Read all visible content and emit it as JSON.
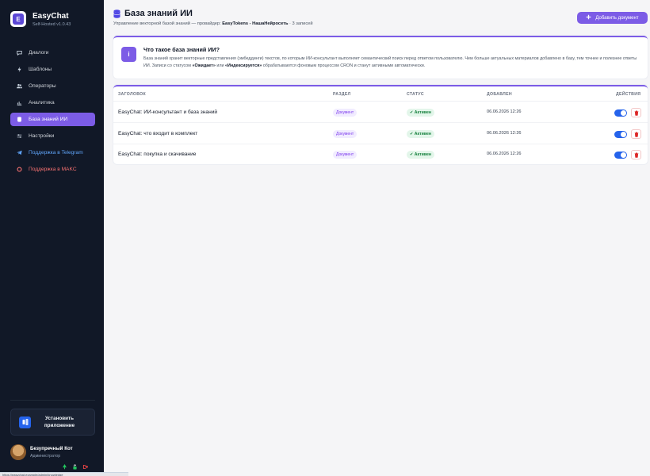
{
  "app": {
    "name": "EasyChat",
    "version": "Self-Hosted v1.0.43",
    "logo_letter": "E"
  },
  "sidebar": {
    "items": [
      {
        "label": "Диалоги",
        "icon": "chat-icon"
      },
      {
        "label": "Шаблоны",
        "icon": "bolt-icon"
      },
      {
        "label": "Операторы",
        "icon": "users-icon"
      },
      {
        "label": "Аналитика",
        "icon": "chart-icon"
      },
      {
        "label": "База знаний ИИ",
        "icon": "database-icon",
        "active": true
      },
      {
        "label": "Настройки",
        "icon": "sliders-icon"
      },
      {
        "label": "Поддержка в Telegram",
        "icon": "telegram-icon"
      },
      {
        "label": "Поддержка в MAKC",
        "icon": "max-icon"
      }
    ],
    "install_label": "Установить приложение",
    "user": {
      "name": "Безупречный Кот",
      "role": "Администратор"
    }
  },
  "status_bar": "https://easychat.example/admin/knowledge",
  "header": {
    "title": "База знаний ИИ",
    "subtitle_prefix": "Управление векторной базой знаний — провайдер:",
    "provider": "EasyTokens - НашаНейросеть",
    "separator": "·",
    "count": "3 записей",
    "add_button": "Добавить документ"
  },
  "info": {
    "icon": "i",
    "title": "Что такое база знаний ИИ?",
    "text_1": "База знаний хранит векторные представления (эмбеддинги) текстов, по которым ИИ-консультант выполняет семантический поиск перед ответом пользователю. Чем больше актуальных материалов добавлено в базу, тем точнее и полезнее ответы ИИ. Записи со статусом",
    "status_waiting": "«Ожидает»",
    "text_or": "или",
    "status_indexing": "«Индексируется»",
    "text_2": "обрабатываются фоновым процессом CRON и станут активными автоматически."
  },
  "table": {
    "headers": {
      "title": "ЗАГОЛОВОК",
      "section": "РАЗДЕЛ",
      "status": "СТАТУС",
      "added": "ДОБАВЛЕН",
      "actions": "ДЕЙСТВИЯ"
    },
    "rows": [
      {
        "title": "EasyChat: ИИ-консультант и база знаний",
        "section": "Документ",
        "status": "Активен",
        "date": "06.06.2026 12:26",
        "enabled": true
      },
      {
        "title": "EasyChat: что входит в комплект",
        "section": "Документ",
        "status": "Активен",
        "date": "06.06.2026 12:26",
        "enabled": true
      },
      {
        "title": "EasyChat: покупка и скачивание",
        "section": "Документ",
        "status": "Активен",
        "date": "06.06.2026 12:26",
        "enabled": true
      }
    ]
  },
  "colors": {
    "accent": "#7c5ce6",
    "sidebar_bg": "#111827",
    "toggle_on": "#2563eb",
    "status_active": "#15803d",
    "danger": "#dc2626"
  }
}
